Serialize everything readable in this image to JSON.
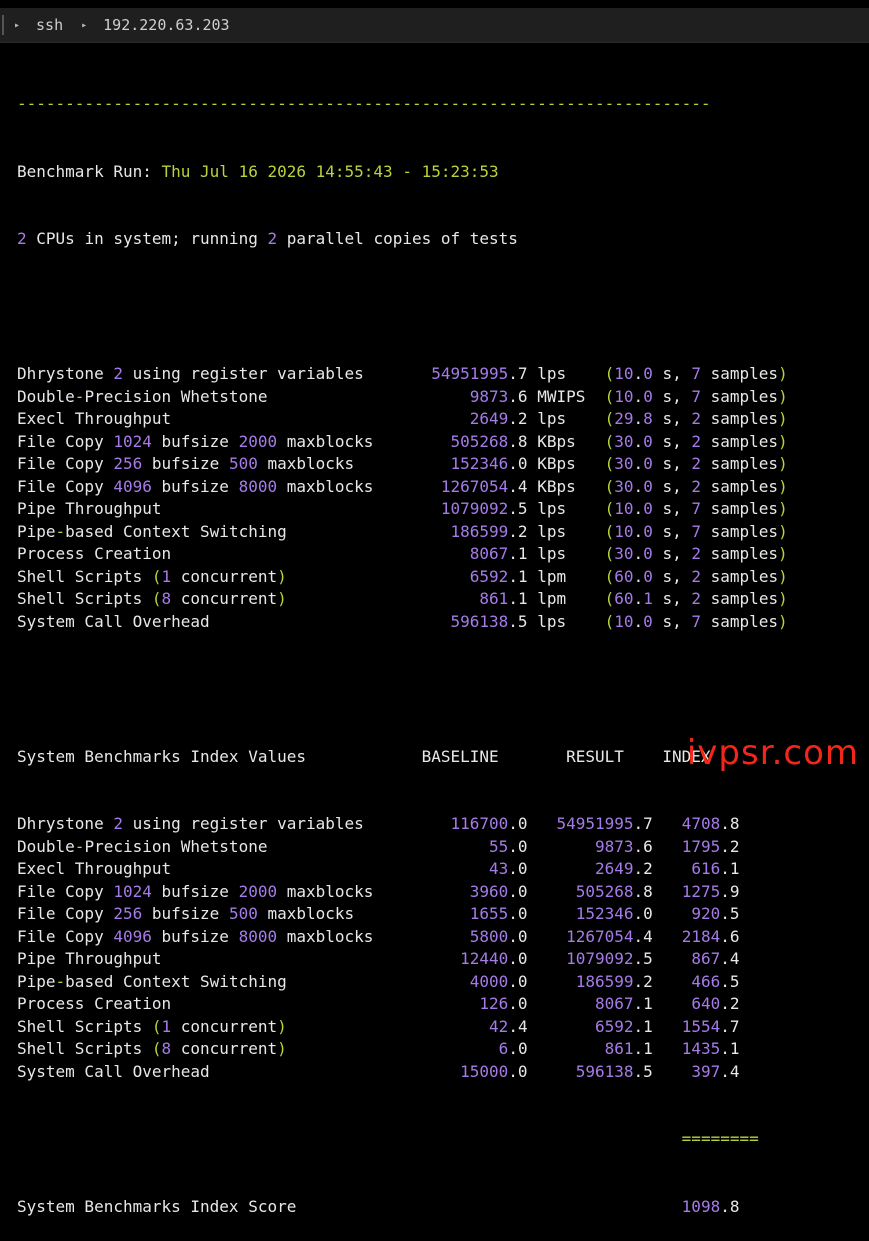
{
  "topbar": {
    "items": [
      "ssh",
      "192.220.63.203"
    ]
  },
  "header": {
    "separator": "------------------------------------------------------------------------",
    "run_label": "Benchmark Run:",
    "run_time": "Thu Jul 16 2026 14:55:43 - 15:23:53",
    "cpus": "2",
    "cpus_text": " CPUs in system; running ",
    "copies": "2",
    "copies_text": " parallel copies of tests"
  },
  "results": [
    {
      "name": "Dhrystone 2 using register variables",
      "value": "54951995.7",
      "unit": "lps",
      "time": "10.0",
      "samples": "7"
    },
    {
      "name": "Double-Precision Whetstone",
      "value": "9873.6",
      "unit": "MWIPS",
      "time": "10.0",
      "samples": "7"
    },
    {
      "name": "Execl Throughput",
      "value": "2649.2",
      "unit": "lps",
      "time": "29.8",
      "samples": "2"
    },
    {
      "name": "File Copy 1024 bufsize 2000 maxblocks",
      "value": "505268.8",
      "unit": "KBps",
      "time": "30.0",
      "samples": "2"
    },
    {
      "name": "File Copy 256 bufsize 500 maxblocks",
      "value": "152346.0",
      "unit": "KBps",
      "time": "30.0",
      "samples": "2"
    },
    {
      "name": "File Copy 4096 bufsize 8000 maxblocks",
      "value": "1267054.4",
      "unit": "KBps",
      "time": "30.0",
      "samples": "2"
    },
    {
      "name": "Pipe Throughput",
      "value": "1079092.5",
      "unit": "lps",
      "time": "10.0",
      "samples": "7"
    },
    {
      "name": "Pipe-based Context Switching",
      "value": "186599.2",
      "unit": "lps",
      "time": "10.0",
      "samples": "7"
    },
    {
      "name": "Process Creation",
      "value": "8067.1",
      "unit": "lps",
      "time": "30.0",
      "samples": "2"
    },
    {
      "name": "Shell Scripts (1 concurrent)",
      "value": "6592.1",
      "unit": "lpm",
      "time": "60.0",
      "samples": "2"
    },
    {
      "name": "Shell Scripts (8 concurrent)",
      "value": "861.1",
      "unit": "lpm",
      "time": "60.1",
      "samples": "2"
    },
    {
      "name": "System Call Overhead",
      "value": "596138.5",
      "unit": "lps",
      "time": "10.0",
      "samples": "7"
    }
  ],
  "index_header": {
    "title": "System Benchmarks Index Values",
    "baseline": "BASELINE",
    "result": "RESULT",
    "index": "INDEX"
  },
  "index": [
    {
      "name": "Dhrystone 2 using register variables",
      "baseline": "116700.0",
      "result": "54951995.7",
      "index": "4708.8"
    },
    {
      "name": "Double-Precision Whetstone",
      "baseline": "55.0",
      "result": "9873.6",
      "index": "1795.2"
    },
    {
      "name": "Execl Throughput",
      "baseline": "43.0",
      "result": "2649.2",
      "index": "616.1"
    },
    {
      "name": "File Copy 1024 bufsize 2000 maxblocks",
      "baseline": "3960.0",
      "result": "505268.8",
      "index": "1275.9"
    },
    {
      "name": "File Copy 256 bufsize 500 maxblocks",
      "baseline": "1655.0",
      "result": "152346.0",
      "index": "920.5"
    },
    {
      "name": "File Copy 4096 bufsize 8000 maxblocks",
      "baseline": "5800.0",
      "result": "1267054.4",
      "index": "2184.6"
    },
    {
      "name": "Pipe Throughput",
      "baseline": "12440.0",
      "result": "1079092.5",
      "index": "867.4"
    },
    {
      "name": "Pipe-based Context Switching",
      "baseline": "4000.0",
      "result": "186599.2",
      "index": "466.5"
    },
    {
      "name": "Process Creation",
      "baseline": "126.0",
      "result": "8067.1",
      "index": "640.2"
    },
    {
      "name": "Shell Scripts (1 concurrent)",
      "baseline": "42.4",
      "result": "6592.1",
      "index": "1554.7"
    },
    {
      "name": "Shell Scripts (8 concurrent)",
      "baseline": "6.0",
      "result": "861.1",
      "index": "1435.1"
    },
    {
      "name": "System Call Overhead",
      "baseline": "15000.0",
      "result": "596138.5",
      "index": "397.4"
    }
  ],
  "score": {
    "equals": "========",
    "label": "System Benchmarks Index Score",
    "value": "1098.8"
  },
  "watermark": "ivpsr.com",
  "colors": {
    "number": "#a57be8",
    "accent": "#b8d33a",
    "text": "#e8e8e8",
    "background": "#000000",
    "watermark": "#ff2a1a"
  }
}
